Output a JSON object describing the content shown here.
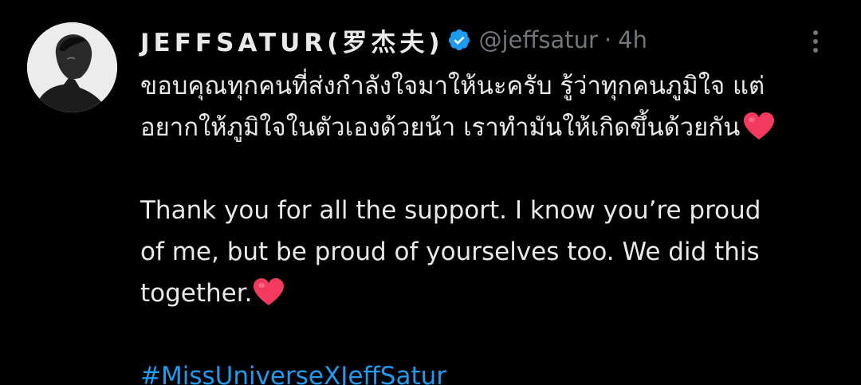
{
  "author": {
    "display_name": "JEFFSATUR(罗杰夫)",
    "handle": "@jeffsatur",
    "separator": "·",
    "timestamp": "4h",
    "verified": true,
    "verified_icon": "verified-badge-icon",
    "avatar_icon": "profile-avatar"
  },
  "tweet": {
    "thai_line_1": "ขอบคุณทุกคนที่ส่งกำลังใจมาให้นะครับ รู้ว่าทุกคนภูมิใจ แต่",
    "thai_line_2": "อยากให้ภูมิใจในตัวเองด้วยน้า เราทำมันให้เกิดขึ้นด้วยกัน",
    "english_line_1": "Thank you for all the support. I know you’re proud",
    "english_line_2": "of me, but be proud of yourselves too. We did this",
    "english_line_3": "together.",
    "emoji_icon": "red-heart-emoji",
    "hashtag": "#MissUniverseXJeffSatur"
  },
  "menu": {
    "more_icon": "more-options-icon"
  },
  "colors": {
    "background": "#000000",
    "text": "#e7e9ea",
    "secondary": "#71767b",
    "accent": "#1d9bf0",
    "heart": "#f4395e"
  }
}
